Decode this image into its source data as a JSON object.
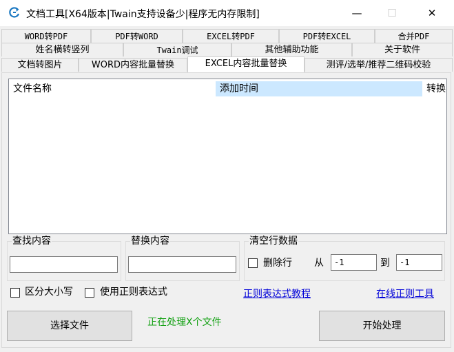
{
  "window": {
    "title": "文档工具[X64版本|Twain支持设备少|程序无内存限制]",
    "minimize_glyph": "—",
    "maximize_glyph": "☐",
    "close_glyph": "✕"
  },
  "tabs": {
    "row1": [
      "WORD转PDF",
      "PDF转WORD",
      "EXCEL转PDF",
      "PDF转EXCEL",
      "合并PDF"
    ],
    "row2": [
      "姓名横转竖列",
      "Twain调试",
      "其他辅助功能",
      "关于软件"
    ],
    "row3": [
      "文档转图片",
      "WORD内容批量替换",
      "EXCEL内容批量替换",
      "测评/选举/推荐二维码校验"
    ],
    "active": "EXCEL内容批量替换"
  },
  "file_list": {
    "columns": [
      "文件名称",
      "添加时间",
      "转换"
    ],
    "selected_column": "添加时间",
    "rows": []
  },
  "find": {
    "label": "查找内容",
    "value": ""
  },
  "replace": {
    "label": "替换内容",
    "value": ""
  },
  "clear_rows": {
    "label": "清空行数据",
    "delete_rows_label": "删除行",
    "delete_rows_checked": false,
    "from_label": "从",
    "from_value": "-1",
    "to_label": "到",
    "to_value": "-1"
  },
  "options": {
    "case_sensitive_label": "区分大小写",
    "case_sensitive_checked": false,
    "use_regex_label": "使用正则表达式",
    "use_regex_checked": false
  },
  "links": {
    "regex_tutorial": "正则表达式教程",
    "online_regex_tool": "在线正则工具"
  },
  "status_text": "正在处理X个文件",
  "buttons": {
    "select_files": "选择文件",
    "start_processing": "开始处理"
  },
  "colors": {
    "link": "#0000d8",
    "status": "#11a011",
    "selected_header": "#cce8ff",
    "app_icon": "#1a78c2"
  }
}
